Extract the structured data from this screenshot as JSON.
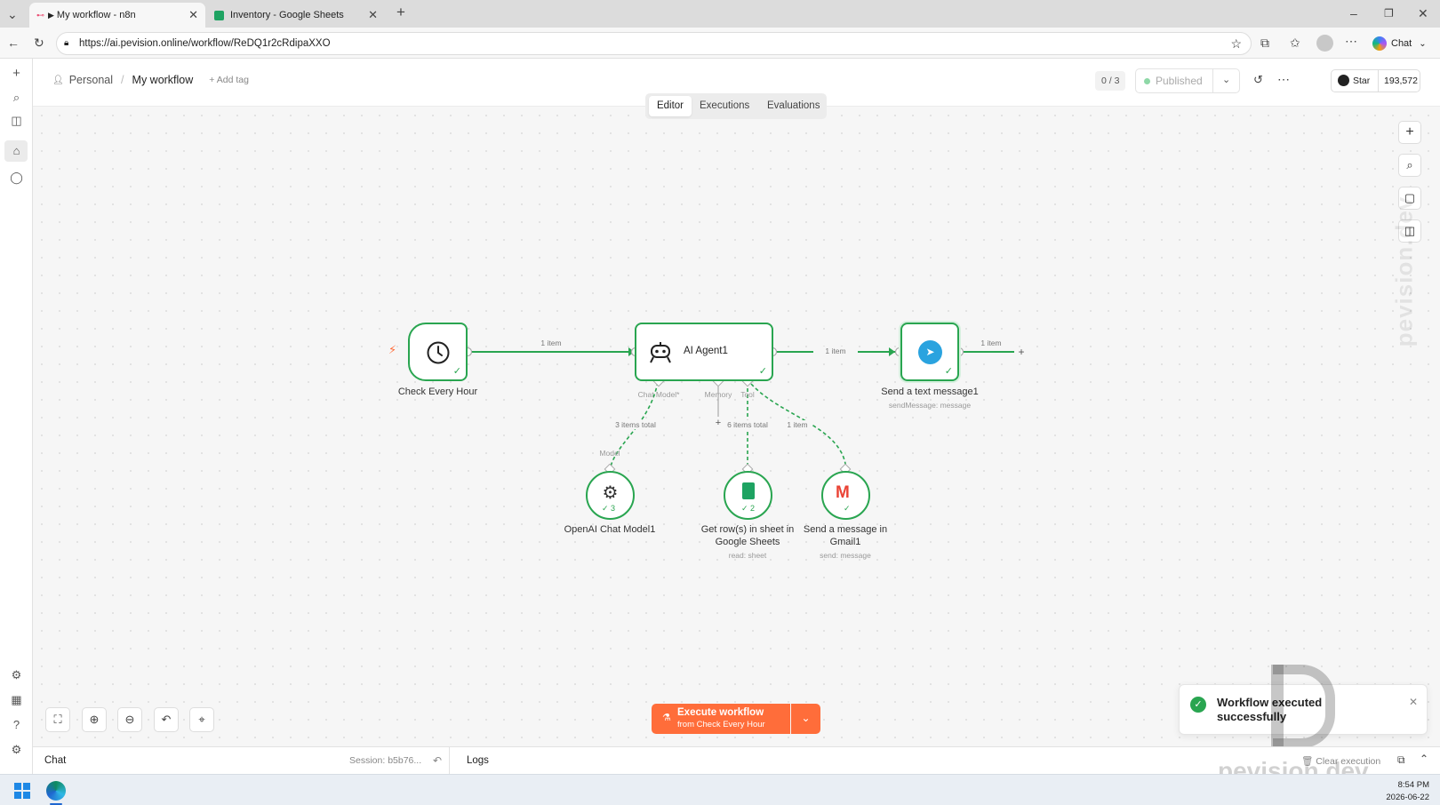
{
  "browser": {
    "tabs": [
      {
        "title": "My workflow - n8n"
      },
      {
        "title": "Inventory - Google Sheets"
      }
    ],
    "url": "https://ai.pevision.online/workflow/ReDQ1r2cRdipaXXO",
    "chat_label": "Chat"
  },
  "header": {
    "project": "Personal",
    "workflow_name": "My workflow",
    "add_tag": "+ Add tag",
    "counter": "0 / 3",
    "publish_status": "Published",
    "github_star": "Star",
    "github_count": "193,572",
    "tabs": [
      "Editor",
      "Executions",
      "Evaluations"
    ],
    "active_tab": "Editor"
  },
  "canvas": {
    "nodes": {
      "trigger": {
        "label": "Check Every Hour"
      },
      "agent": {
        "label": "AI Agent1"
      },
      "telegram": {
        "label": "Send a text message1",
        "sub": "sendMessage: message"
      },
      "openai": {
        "label": "OpenAI Chat Model1",
        "badge": "3"
      },
      "sheets": {
        "label": "Get row(s) in sheet in Google Sheets",
        "sub": "read: sheet",
        "badge": "2"
      },
      "gmail": {
        "label": "Send a message in Gmail1",
        "sub": "send: message"
      }
    },
    "edges": {
      "trigger_agent": "1 item",
      "agent_telegram": "1 item",
      "telegram_out": "1 item",
      "model": "3 items total",
      "tool_sheets": "6 items total",
      "tool_gmail": "1 item"
    },
    "ports": {
      "chat_model": "Chat Model*",
      "memory": "Memory",
      "tool": "Tool",
      "model": "Model"
    }
  },
  "execute": {
    "label": "Execute workflow",
    "sub": "from Check Every Hour"
  },
  "bottom": {
    "chat": "Chat",
    "session": "Session: b5b76...",
    "logs": "Logs",
    "clear": "Clear execution"
  },
  "toast": {
    "message": "Workflow executed successfully"
  },
  "watermark": {
    "side": "pevision.dev",
    "bottom": "pevision.dev"
  },
  "taskbar": {
    "time": "8:54 PM",
    "date": "2026-06-22"
  },
  "colors": {
    "accent_green": "#29a550",
    "execute_orange": "#ff6d3a",
    "telegram_blue": "#2aa3df"
  }
}
